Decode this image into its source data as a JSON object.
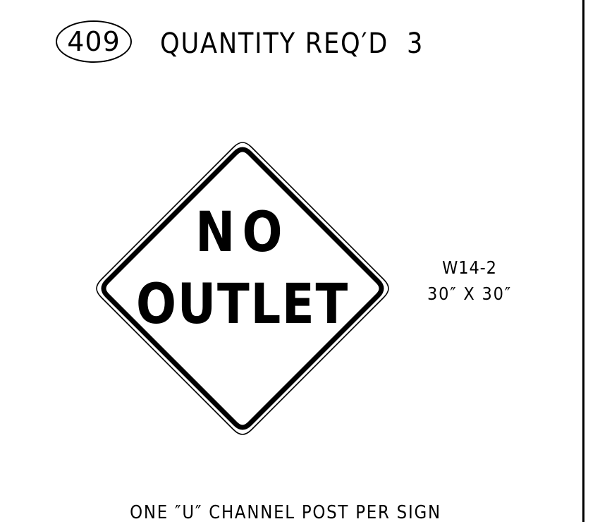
{
  "header": {
    "item_number": "409",
    "quantity_label": "QUANTITY REQ′D  3"
  },
  "sign": {
    "line1": "NO",
    "line2": "OUTLET",
    "code": "W14-2",
    "size": "30″ X 30″",
    "border_color": "#000000",
    "background_color": "#ffffff"
  },
  "footer": {
    "note": "ONE ″U″ CHANNEL POST PER SIGN"
  }
}
